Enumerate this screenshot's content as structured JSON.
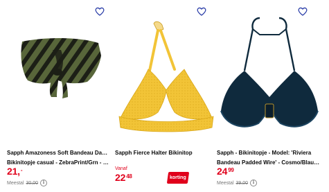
{
  "colors": {
    "price_red": "#e0001b",
    "heart_blue": "#2b3ea8",
    "text_dark": "#0a0a0a",
    "muted": "#777777"
  },
  "products": [
    {
      "title_line1": "Sapph Amazoness Soft Bandeau Dames",
      "title_line2": "Bikinitopje casual - ZebraPrint/Grn - Maat...",
      "price_main": "21,",
      "price_cents": "-",
      "was_label": "Meestal",
      "was_price": "30,00",
      "favorite_icon": "heart-outline-icon",
      "info_icon": "info-icon",
      "image_icon": "bandeau-bikini-top-image"
    },
    {
      "title_line1": "Sapph Fierce Halter Bikinitop",
      "title_line2": "",
      "from_label": "Vanaf",
      "price_main": "22",
      "price_cents": "48",
      "badge_label": "korting",
      "favorite_icon": "heart-outline-icon",
      "image_icon": "halter-bikini-top-image"
    },
    {
      "title_line1": "Sapph - Bikinitopje - Model: 'Riviera",
      "title_line2": "Bandeau Padded Wire' - Cosmo/Blauw -...",
      "price_main": "24",
      "price_cents": "99",
      "was_label": "Meestal",
      "was_price": "39,00",
      "favorite_icon": "heart-outline-icon",
      "info_icon": "info-icon",
      "image_icon": "wired-halter-bikini-top-image"
    }
  ]
}
